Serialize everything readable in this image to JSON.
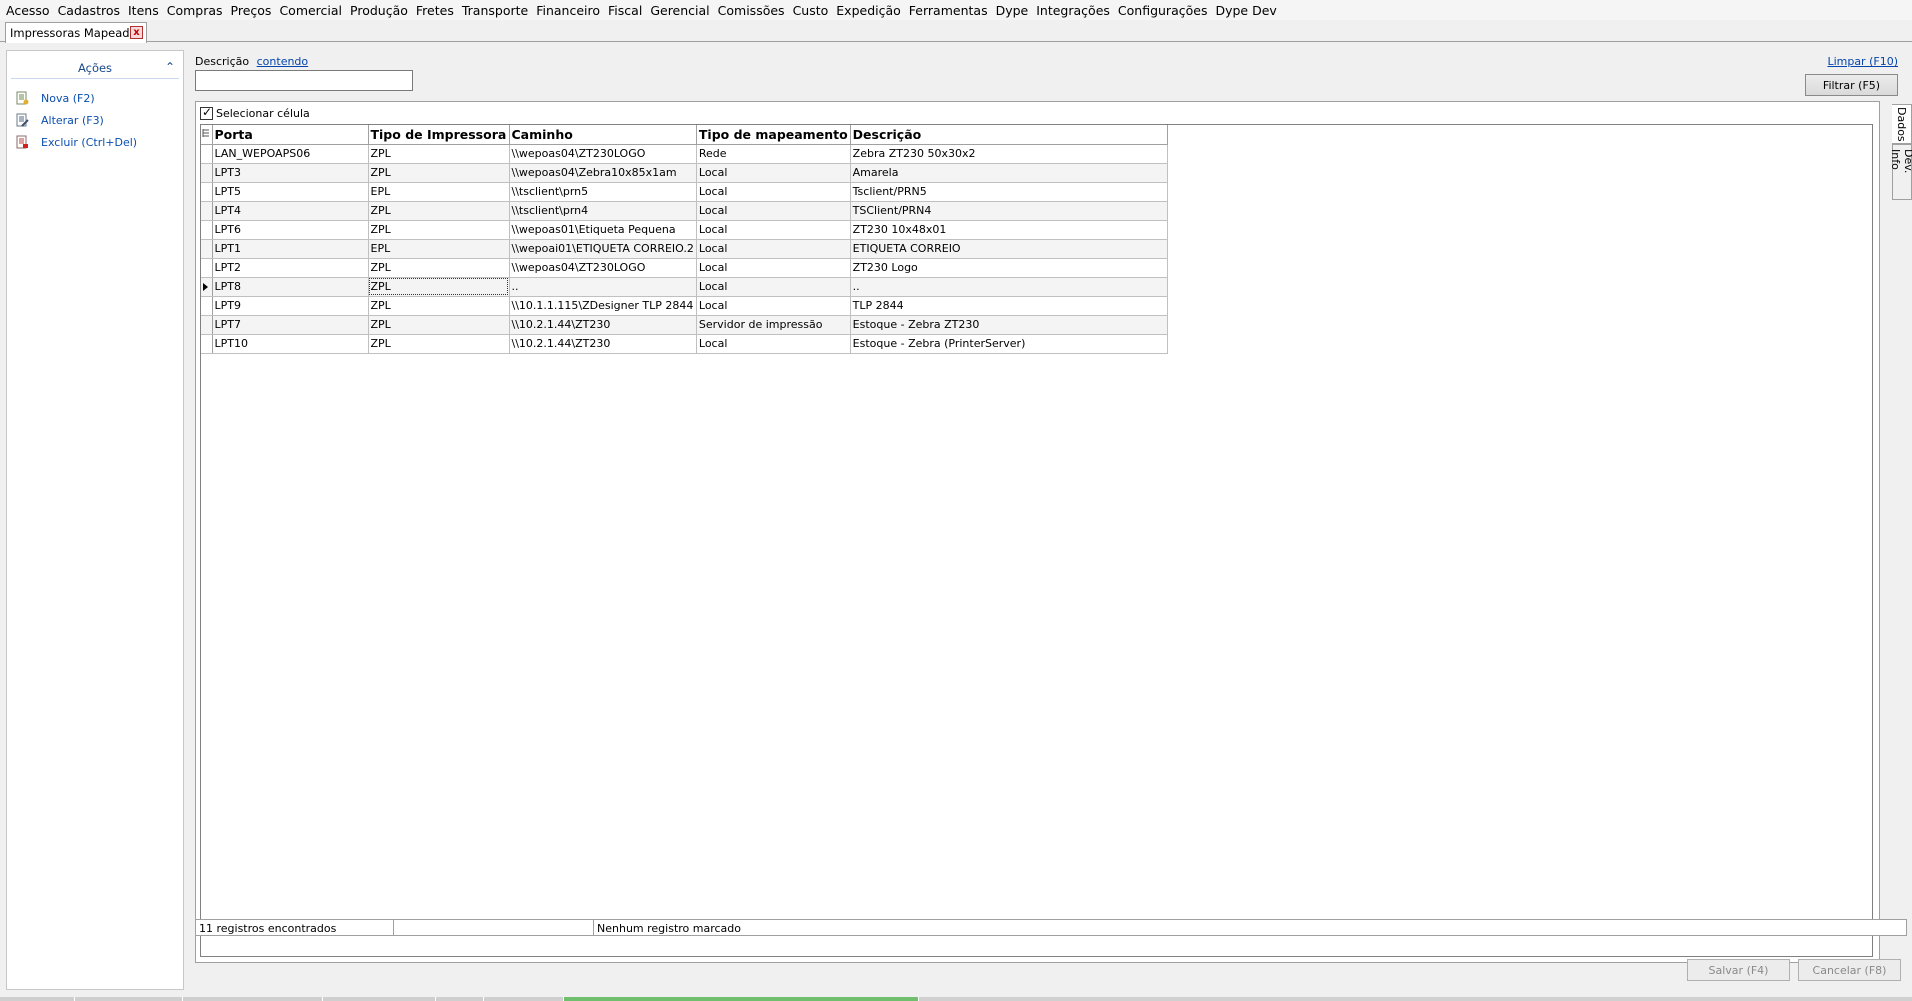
{
  "menu": [
    "Acesso",
    "Cadastros",
    "Itens",
    "Compras",
    "Preços",
    "Comercial",
    "Produção",
    "Fretes",
    "Transporte",
    "Financeiro",
    "Fiscal",
    "Gerencial",
    "Comissões",
    "Custo",
    "Expedição",
    "Ferramentas",
    "Dype",
    "Integrações",
    "Configurações",
    "Dype Dev"
  ],
  "tab": {
    "title": "Impressoras Mapeadas",
    "close": "x"
  },
  "actions_panel": {
    "title": "Ações",
    "collapse_glyph": "⌃",
    "items": [
      {
        "label": "Nova (F2)",
        "icon": "new-document-icon"
      },
      {
        "label": "Alterar (F3)",
        "icon": "edit-document-icon"
      },
      {
        "label": "Excluir (Ctrl+Del)",
        "icon": "delete-document-icon"
      }
    ]
  },
  "filter": {
    "label": "Descrição",
    "mode": "contendo",
    "value": "",
    "clear_label": "Limpar (F10)",
    "button_label": "Filtrar (F5)"
  },
  "grid": {
    "select_cell_label": "Selecionar célula",
    "select_cell_checked": true,
    "columns": [
      "Porta",
      "Tipo de Impressora",
      "Caminho",
      "Tipo de mapeamento",
      "Descrição"
    ],
    "current_row": 7,
    "rows": [
      [
        "LAN_WEPOAPS06",
        "ZPL",
        "\\\\wepoas04\\ZT230LOGO",
        "Rede",
        "Zebra ZT230 50x30x2"
      ],
      [
        "LPT3",
        "ZPL",
        "\\\\wepoas04\\Zebra10x85x1am",
        "Local",
        "Amarela"
      ],
      [
        "LPT5",
        "EPL",
        "\\\\tsclient\\prn5",
        "Local",
        "Tsclient/PRN5"
      ],
      [
        "LPT4",
        "ZPL",
        "\\\\tsclient\\prn4",
        "Local",
        "TSClient/PRN4"
      ],
      [
        "LPT6",
        "ZPL",
        "\\\\wepoas01\\Etiqueta Pequena",
        "Local",
        "ZT230 10x48x01"
      ],
      [
        "LPT1",
        "EPL",
        "\\\\wepoai01\\ETIQUETA CORREIO.2",
        "Local",
        "ETIQUETA CORREIO"
      ],
      [
        "LPT2",
        "ZPL",
        "\\\\wepoas04\\ZT230LOGO",
        "Local",
        "ZT230 Logo"
      ],
      [
        "LPT8",
        "ZPL",
        "..",
        "Local",
        ".."
      ],
      [
        "LPT9",
        "ZPL",
        "\\\\10.1.1.115\\ZDesigner TLP 2844",
        "Local",
        "TLP 2844"
      ],
      [
        "LPT7",
        "ZPL",
        "\\\\10.2.1.44\\ZT230",
        "Servidor de impressão",
        "Estoque - Zebra ZT230"
      ],
      [
        "LPT10",
        "ZPL",
        "\\\\10.2.1.44\\ZT230",
        "Local",
        "Estoque  - Zebra (PrinterServer)"
      ]
    ]
  },
  "side_tabs": [
    "Dados",
    "Dev. Info"
  ],
  "status": {
    "count": "11 registros encontrados",
    "middle": "",
    "marked": "Nenhum registro marcado"
  },
  "buttons": {
    "save": "Salvar (F4)",
    "cancel": "Cancelar (F8)"
  }
}
